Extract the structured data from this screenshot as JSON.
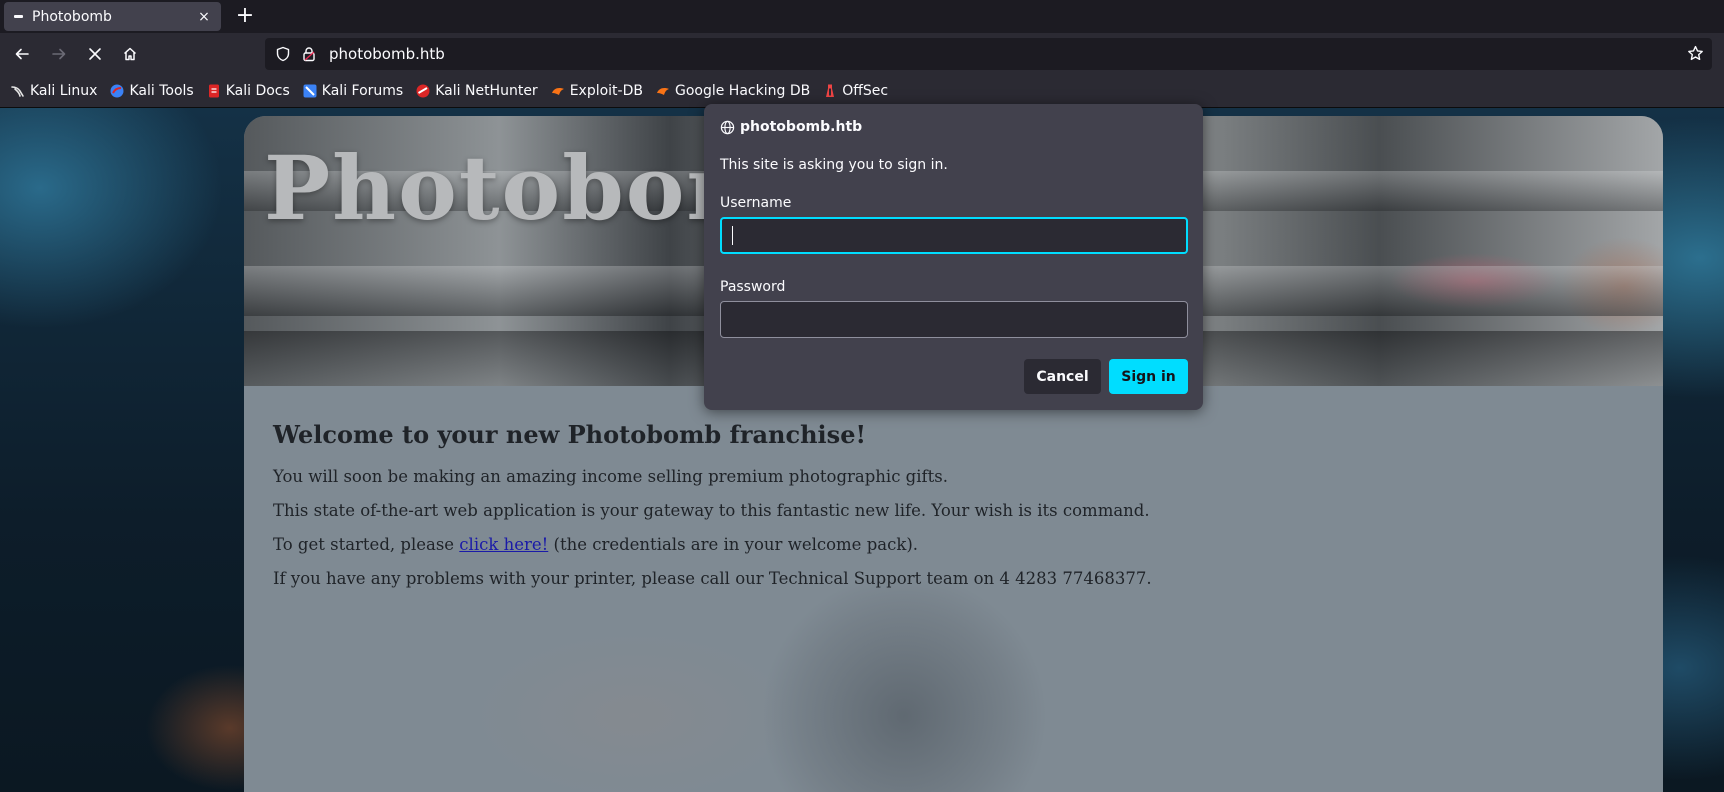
{
  "browser": {
    "tab": {
      "title": "Photobomb",
      "close_icon": "×"
    },
    "new_tab_icon": "+",
    "url": "photobomb.htb",
    "bookmarks": [
      {
        "label": "Kali Linux",
        "icon": "kali-dragon-icon",
        "color": "#e6e6e6"
      },
      {
        "label": "Kali Tools",
        "icon": "kali-tools-icon",
        "color": "#3b82f6"
      },
      {
        "label": "Kali Docs",
        "icon": "kali-docs-icon",
        "color": "#dc2626"
      },
      {
        "label": "Kali Forums",
        "icon": "kali-forums-icon",
        "color": "#3b82f6"
      },
      {
        "label": "Kali NetHunter",
        "icon": "kali-nethunter-icon",
        "color": "#dc2626"
      },
      {
        "label": "Exploit-DB",
        "icon": "exploit-db-icon",
        "color": "#f97316"
      },
      {
        "label": "Google Hacking DB",
        "icon": "ghdb-icon",
        "color": "#f97316"
      },
      {
        "label": "OffSec",
        "icon": "offsec-icon",
        "color": "#ef4444"
      }
    ]
  },
  "page": {
    "hero_title": "Photobomb",
    "heading": "Welcome to your new Photobomb franchise!",
    "p1": "You will soon be making an amazing income selling premium photographic gifts.",
    "p2": "This state of-the-art web application is your gateway to this fantastic new life. Your wish is its command.",
    "p3_before": "To get started, please ",
    "p3_link": "click here!",
    "p3_after": " (the credentials are in your welcome pack).",
    "p4": "If you have any problems with your printer, please call our Technical Support team on 4 4283 77468377."
  },
  "auth_dialog": {
    "host": "photobomb.htb",
    "message": "This site is asking you to sign in.",
    "username_label": "Username",
    "username_value": "",
    "password_label": "Password",
    "password_value": "",
    "cancel_label": "Cancel",
    "signin_label": "Sign in",
    "accent_color": "#00ddff"
  }
}
